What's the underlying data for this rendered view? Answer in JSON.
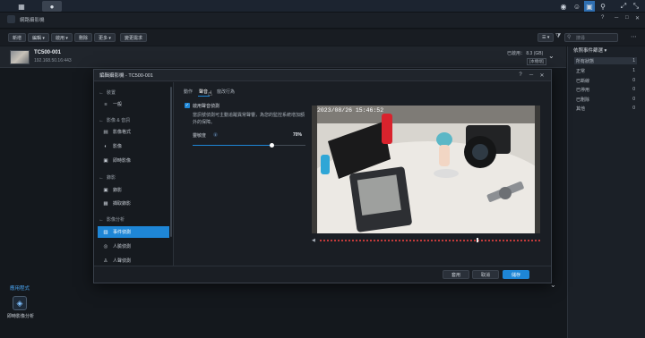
{
  "taskbar": {
    "btn1_icon": "grid-icon",
    "btn2_icon": "camera-app-icon",
    "right_icons": [
      "chat-icon",
      "user-icon",
      "widget-icon",
      "search-icon",
      "help-icon",
      "close-icon",
      "expand-icon",
      "collapse-icon"
    ]
  },
  "app": {
    "title": "網路攝影機"
  },
  "toolbar": {
    "buttons": [
      "新增",
      "編輯 ▾",
      "啟用 ▾",
      "刪除",
      "更多 ▾",
      "變更需求"
    ],
    "search_placeholder": "搜尋"
  },
  "camera": {
    "name": "TC500-001",
    "ip": "192.168.50.16:443",
    "status": "已啟用： 8.3 (GB)",
    "tag": "[本機端]"
  },
  "right_panel": {
    "title": "依照事件篩選 ▾",
    "items": [
      {
        "label": "所有狀態",
        "count": "1"
      },
      {
        "label": "正常",
        "count": "1"
      },
      {
        "label": "已斷線",
        "count": "0"
      },
      {
        "label": "已停用",
        "count": "0"
      },
      {
        "label": "已刪除",
        "count": "0"
      },
      {
        "label": "其他",
        "count": "0"
      }
    ]
  },
  "apps": {
    "label": "應用程式",
    "app_name": "即時影像分析"
  },
  "dialog": {
    "title": "編輯攝影機 - TC500-001",
    "controls": [
      "?",
      "─",
      "□",
      "✕"
    ],
    "sidebar": {
      "sections": [
        {
          "title": "裝置",
          "items": [
            "一般"
          ]
        },
        {
          "title": "影像 & 音訊",
          "items": [
            "影像格式",
            "影像",
            "即時影像"
          ]
        },
        {
          "title": "錄影",
          "items": [
            "錄影",
            "擷取錄影"
          ]
        },
        {
          "title": "影像分析",
          "items": [
            "事件偵測",
            "人臉偵測",
            "人聲偵測"
          ]
        }
      ],
      "active": "事件偵測"
    },
    "tabs": [
      "動作",
      "聲音",
      "竄改行為"
    ],
    "active_tab": "聲音",
    "checkbox_label": "啟用聲音偵測",
    "description": "當訊號偵測可主動追蹤異常聲響，為您的監控系統增加額外的保障。",
    "sensitivity_label": "靈敏度",
    "sensitivity_value": "70%",
    "sensitivity_level": 0.7,
    "timestamp": "2023/08/26 15:46:52",
    "audio_level": 0.71,
    "buttons": {
      "apply": "套用",
      "cancel": "取消",
      "save": "儲存"
    }
  }
}
